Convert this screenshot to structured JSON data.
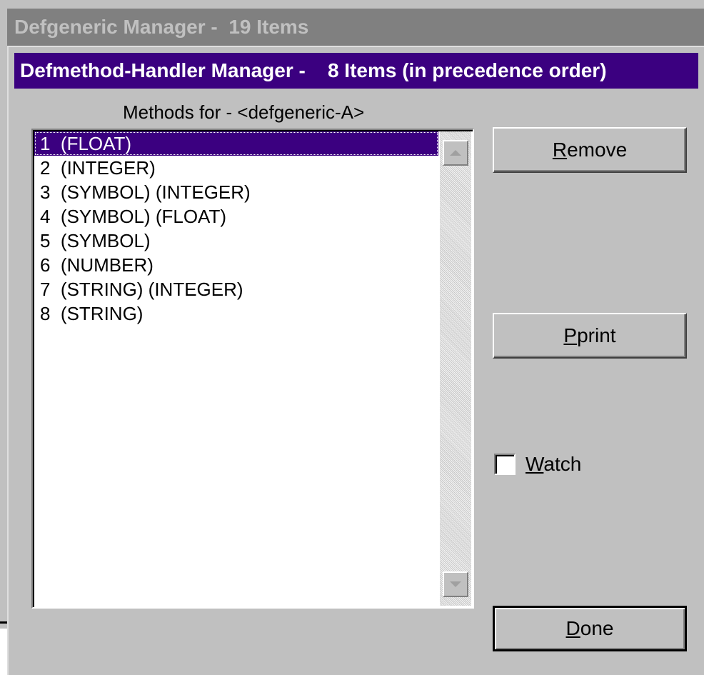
{
  "background_window": {
    "title_name": "Defgeneric Manager",
    "title_sep": " -  ",
    "title_count": "19 Items"
  },
  "dialog": {
    "title_name": "Defmethod-Handler Manager",
    "title_sep": " -    ",
    "title_count": "8 Items (in precedence order)"
  },
  "methods_label": "Methods for - <defgeneric-A>",
  "methods": [
    {
      "label": "1  (FLOAT)",
      "selected": true
    },
    {
      "label": "2  (INTEGER)",
      "selected": false
    },
    {
      "label": "3  (SYMBOL) (INTEGER)",
      "selected": false
    },
    {
      "label": "4  (SYMBOL) (FLOAT)",
      "selected": false
    },
    {
      "label": "5  (SYMBOL)",
      "selected": false
    },
    {
      "label": "6  (NUMBER)",
      "selected": false
    },
    {
      "label": "7  (STRING) (INTEGER)",
      "selected": false
    },
    {
      "label": "8  (STRING)",
      "selected": false
    }
  ],
  "buttons": {
    "remove": {
      "mnemonic": "R",
      "rest": "emove"
    },
    "pprint": {
      "mnemonic": "P",
      "rest": "print"
    },
    "done": {
      "mnemonic": "D",
      "rest": "one"
    }
  },
  "watch": {
    "mnemonic": "W",
    "rest": "atch",
    "checked": false
  },
  "colors": {
    "active_title": "#3b0080",
    "inactive_title": "#808080",
    "face": "#c0c0c0"
  }
}
